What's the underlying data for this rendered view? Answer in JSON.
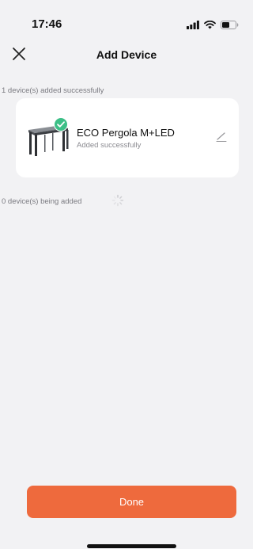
{
  "status_bar": {
    "time": "17:46"
  },
  "header": {
    "title": "Add Device"
  },
  "added_section": {
    "label": "1 device(s) added successfully"
  },
  "device": {
    "name": "ECO Pergola M+LED",
    "status": "Added successfully"
  },
  "adding_section": {
    "label": "0 device(s) being added"
  },
  "footer": {
    "done_label": "Done"
  },
  "colors": {
    "accent": "#ee6a3d",
    "success": "#3dbf87",
    "background": "#f2f2f4",
    "card": "#ffffff"
  },
  "icons": [
    "signal-icon",
    "wifi-icon",
    "battery-icon",
    "close-icon",
    "pergola-icon",
    "check-badge-icon",
    "edit-icon",
    "loading-spinner-icon"
  ]
}
